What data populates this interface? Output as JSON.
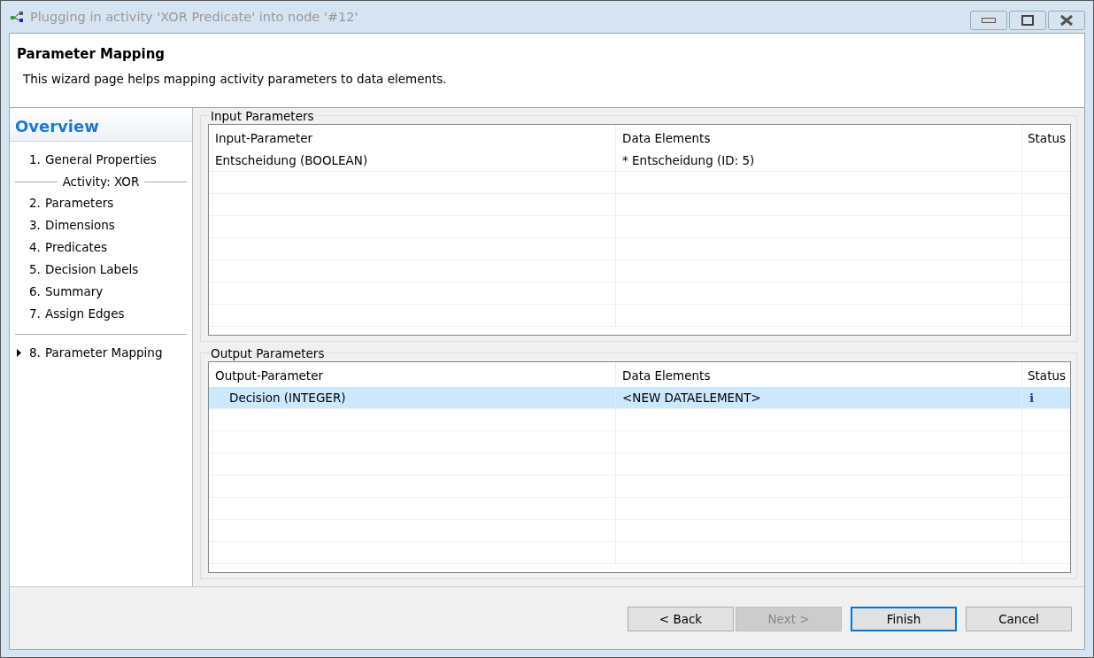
{
  "window": {
    "title": "Plugging in activity 'XOR Predicate' into node '#12'"
  },
  "header": {
    "title": "Parameter Mapping",
    "description": "This wizard page helps mapping activity parameters to data elements."
  },
  "overview": {
    "title": "Overview",
    "steps": [
      {
        "kind": "step",
        "number": "1.",
        "label": "General Properties",
        "current": false
      },
      {
        "kind": "separator",
        "label": "Activity: XOR"
      },
      {
        "kind": "step",
        "number": "2.",
        "label": "Parameters",
        "current": false
      },
      {
        "kind": "step",
        "number": "3.",
        "label": "Dimensions",
        "current": false
      },
      {
        "kind": "step",
        "number": "4.",
        "label": "Predicates",
        "current": false
      },
      {
        "kind": "step",
        "number": "5.",
        "label": "Decision Labels",
        "current": false
      },
      {
        "kind": "step",
        "number": "6.",
        "label": "Summary",
        "current": false
      },
      {
        "kind": "step",
        "number": "7.",
        "label": "Assign Edges",
        "current": false
      },
      {
        "kind": "rule"
      },
      {
        "kind": "step",
        "number": "8.",
        "label": "Parameter Mapping",
        "current": true
      }
    ]
  },
  "input_parameters": {
    "title": "Input Parameters",
    "columns": [
      "Input-Parameter",
      "Data Elements",
      "Status"
    ],
    "rows": [
      {
        "cells": [
          "Entscheidung  (BOOLEAN)",
          "* Entscheidung  (ID: 5)",
          ""
        ],
        "selected": false
      }
    ]
  },
  "output_parameters": {
    "title": "Output Parameters",
    "columns": [
      "Output-Parameter",
      "Data Elements",
      "Status"
    ],
    "rows": [
      {
        "cells": [
          "Decision  (INTEGER)",
          "<NEW DATAELEMENT>",
          "i"
        ],
        "selected": true
      }
    ]
  },
  "buttons": [
    {
      "label": "< Back",
      "disabled": false,
      "default": false
    },
    {
      "label": "Next >",
      "disabled": true,
      "default": false
    },
    {
      "label": "Finish",
      "disabled": false,
      "default": true
    },
    {
      "label": "Cancel",
      "disabled": false,
      "default": false
    }
  ]
}
